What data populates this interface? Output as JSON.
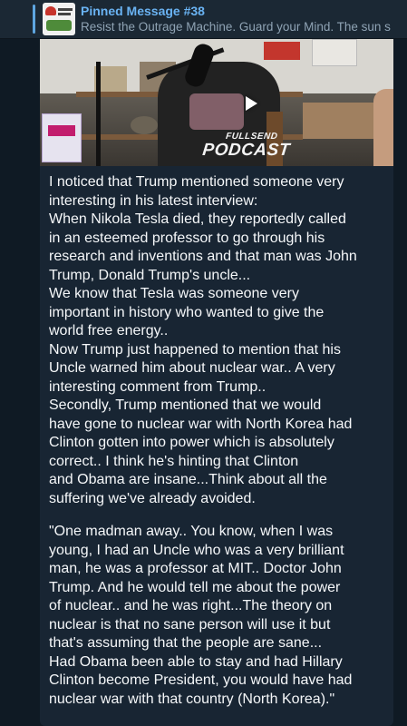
{
  "pinned": {
    "title": "Pinned Message #38",
    "text": "Resist the Outrage Machine.  Guard your Mind.   The sun s"
  },
  "video": {
    "logo_line1": "FULLSEND",
    "logo_line2": "PODCAST",
    "play_icon": "play-icon"
  },
  "message": {
    "body": "I noticed that Trump mentioned someone very\ninteresting in his latest interview:\nWhen Nikola Tesla died, they reportedly called\nin an esteemed professor to go through his\nresearch and inventions and that man was John\nTrump, Donald Trump's uncle...\nWe know that Tesla was someone very\nimportant in history who wanted to give the\nworld free energy..\nNow Trump just happened to mention that his\nUncle warned him about nuclear war.. A very\ninteresting comment from Trump..\nSecondly, Trump mentioned that we would\nhave gone to nuclear war with North Korea had\nClinton gotten into power which is absolutely\ncorrect.. I think he's hinting that Clinton\nand Obama are insane...Think about all the\nsuffering we've already avoided.",
    "quote": "\"One madman away.. You know, when I was\nyoung, I had an Uncle who was a very brilliant\nman, he was a professor at MIT.. Doctor John\nTrump. And he would tell me about the power\nof nuclear.. and he was right...The theory on\nnuclear is that no sane person will use it but\nthat's assuming that the people are sane...\nHad Obama been able to stay and had Hillary\nClinton become President, you would have had\nnuclear war with that country (North Korea).\""
  },
  "colors": {
    "accent": "#6ab3f3",
    "bubble": "#182533",
    "background": "#0f1a24"
  }
}
